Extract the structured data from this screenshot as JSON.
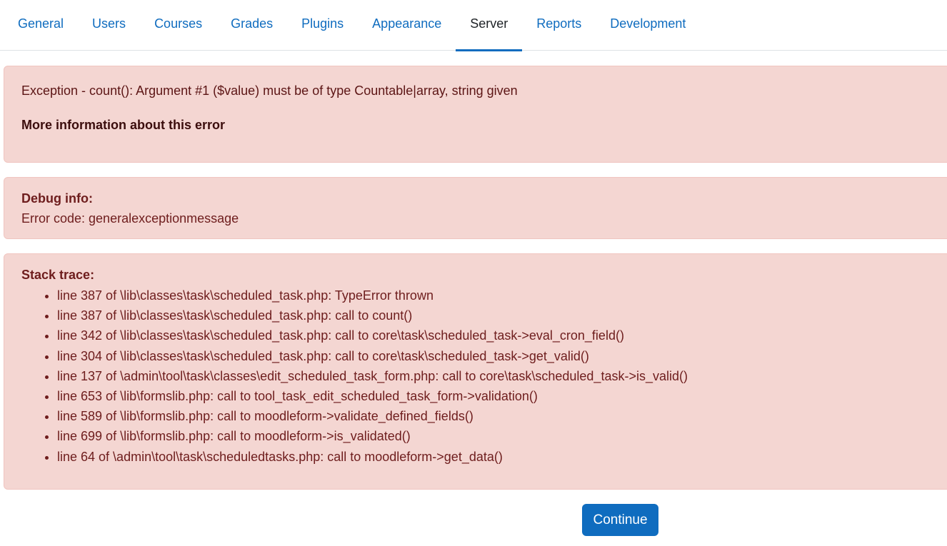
{
  "nav": {
    "tabs": [
      {
        "label": "General",
        "active": false
      },
      {
        "label": "Users",
        "active": false
      },
      {
        "label": "Courses",
        "active": false
      },
      {
        "label": "Grades",
        "active": false
      },
      {
        "label": "Plugins",
        "active": false
      },
      {
        "label": "Appearance",
        "active": false
      },
      {
        "label": "Server",
        "active": true
      },
      {
        "label": "Reports",
        "active": false
      },
      {
        "label": "Development",
        "active": false
      }
    ]
  },
  "exception": {
    "message": "Exception - count(): Argument #1 ($value) must be of type Countable|array, string given",
    "more_info_link": "More information about this error"
  },
  "debug": {
    "heading": "Debug info:",
    "error_code": "Error code: generalexceptionmessage"
  },
  "stack": {
    "heading": "Stack trace:",
    "lines": [
      "line 387 of \\lib\\classes\\task\\scheduled_task.php: TypeError thrown",
      "line 387 of \\lib\\classes\\task\\scheduled_task.php: call to count()",
      "line 342 of \\lib\\classes\\task\\scheduled_task.php: call to core\\task\\scheduled_task->eval_cron_field()",
      "line 304 of \\lib\\classes\\task\\scheduled_task.php: call to core\\task\\scheduled_task->get_valid()",
      "line 137 of \\admin\\tool\\task\\classes\\edit_scheduled_task_form.php: call to core\\task\\scheduled_task->is_valid()",
      "line 653 of \\lib\\formslib.php: call to tool_task_edit_scheduled_task_form->validation()",
      "line 589 of \\lib\\formslib.php: call to moodleform->validate_defined_fields()",
      "line 699 of \\lib\\formslib.php: call to moodleform->is_validated()",
      "line 64 of \\admin\\tool\\task\\scheduledtasks.php: call to moodleform->get_data()"
    ]
  },
  "actions": {
    "continue_label": "Continue"
  },
  "colors": {
    "primary": "#0f6cbf",
    "alert_bg": "#f4d6d2",
    "alert_text": "#6e1d1d"
  }
}
